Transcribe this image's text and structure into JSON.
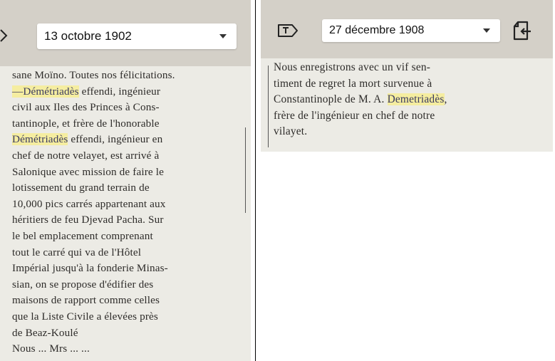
{
  "left_clip": {
    "date": "13 octobre 1902",
    "icon": "chevron-right-icon",
    "lines": [
      [
        "sane Moïno. Toutes nos félicitations."
      ],
      [
        "",
        {
          "hl": "—Démétriadès"
        },
        " effendi, ingénieur"
      ],
      [
        "civil aux Iles des Princes à Cons-"
      ],
      [
        "tantinople, et frère de l'honorable"
      ],
      [
        "",
        {
          "hl": "Démétriadès"
        },
        " effendi, ingénieur en"
      ],
      [
        "chef de notre velayet, est arrivé à"
      ],
      [
        "Salonique avec mission de faire le"
      ],
      [
        "lotissement du grand terrain de"
      ],
      [
        "10,000 pics carrés appartenant aux"
      ],
      [
        "héritiers de feu Djevad Pacha. Sur"
      ],
      [
        "le bel emplacement comprenant"
      ],
      [
        "tout le carré qui va de l'Hôtel"
      ],
      [
        "Impérial jusqu'à la fonderie Minas-"
      ],
      [
        "sian, on se propose d'édifier des"
      ],
      [
        "maisons de rapport comme celles"
      ],
      [
        "que la Liste Civile a élevées près"
      ],
      [
        "de Beaz-Koulé"
      ],
      [
        "Nous ...          Mrs ...      ..."
      ]
    ]
  },
  "right_clip": {
    "date": "27 décembre 1908",
    "tag_icon": "text-tag-icon",
    "clip_icon": "clip-add-icon",
    "lines": [
      [
        "Nous enregistrons avec un vif sen-"
      ],
      [
        "timent de regret la mort survenue à"
      ],
      [
        "Constantinople de M. A. ",
        {
          "hl": "Demetriadès"
        },
        ","
      ],
      [
        "frère de l'ingénieur en chef de notre"
      ],
      [
        "vilayet."
      ]
    ]
  },
  "colors": {
    "toolbar": "#d4d0c8",
    "scan": "#ecebe5",
    "highlight": "#f5eda0",
    "ink": "#2d2b29"
  }
}
